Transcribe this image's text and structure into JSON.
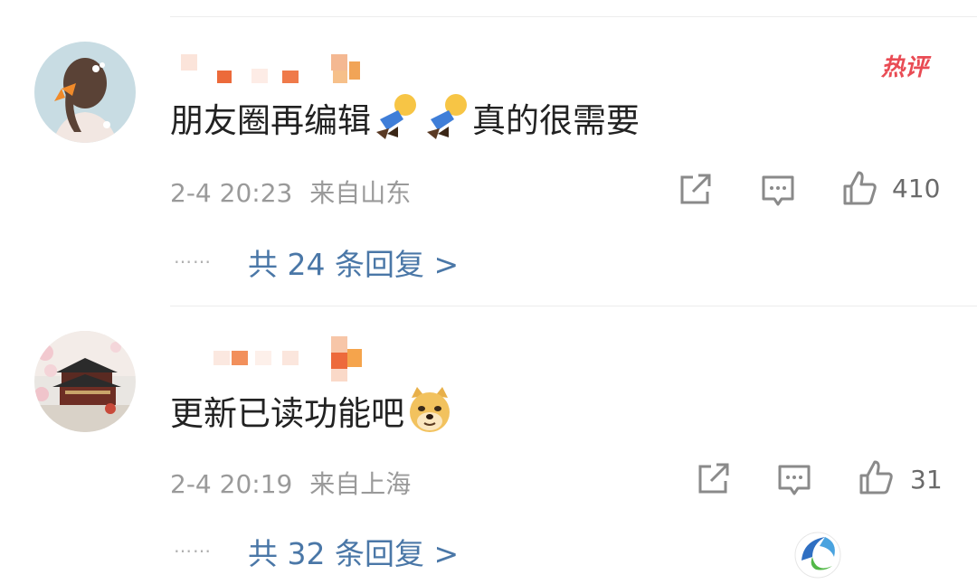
{
  "comments": [
    {
      "text": "朋友圈再编辑",
      "text_after": "真的很需要",
      "emoji": [
        "worker-emoji",
        "worker-emoji"
      ],
      "badge": "热评",
      "timestamp": "2-4 20:23",
      "location": "来自山东",
      "likes": "410",
      "dots": "……",
      "replies": "共 24 条回复 >"
    },
    {
      "text": "更新已读功能吧",
      "emoji": [
        "doge-emoji"
      ],
      "timestamp": "2-4 20:19",
      "location": "来自上海",
      "likes": "31",
      "dots": "……",
      "replies": "共 32 条回复 >"
    }
  ],
  "colors": {
    "link": "#4a77a7",
    "hot_badge": "#e94b54",
    "meta": "#9a9a9a",
    "text": "#222222"
  }
}
